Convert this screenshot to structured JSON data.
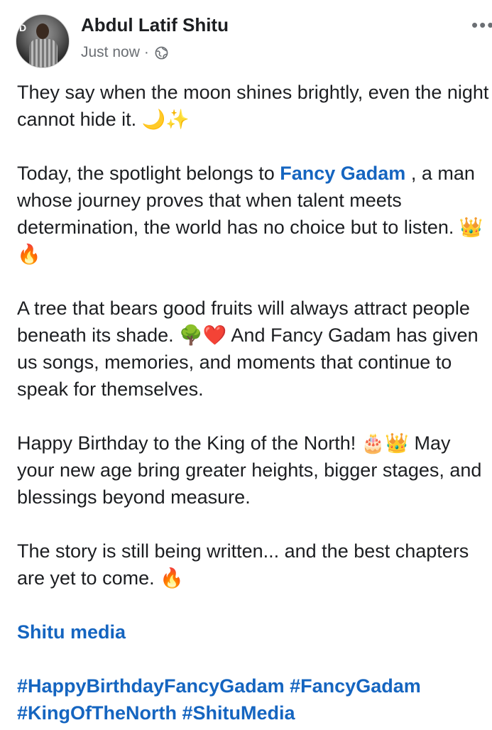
{
  "author": {
    "name": "Abdul Latif Shitu",
    "time": "Just now",
    "separator": "·"
  },
  "post": {
    "p1": "They say when the moon shines brightly, even the night cannot hide it. 🌙✨",
    "p2_before": "Today, the spotlight belongs to ",
    "p2_mention": "Fancy Gadam",
    "p2_after": " , a man whose journey proves that when talent meets determination, the world has no choice but to listen. 👑🔥",
    "p3": "A tree that bears good fruits will always attract people beneath its shade. 🌳❤️ And Fancy Gadam has given us songs, memories, and moments that continue to speak for themselves.",
    "p4": "Happy Birthday to the King of the North! 🎂👑 May your new age bring greater heights, bigger stages, and blessings beyond measure.",
    "p5": "The story is still being written... and the best chapters are yet to come. 🔥",
    "signature": "Shitu media",
    "hashtags": [
      "#HappyBirthdayFancyGadam",
      "#FancyGadam",
      "#KingOfTheNorth",
      "#ShituMedia"
    ]
  },
  "icons": {
    "privacy": "globe-icon",
    "more": "more-options-icon"
  },
  "colors": {
    "link": "#1565c0",
    "text": "#1c1e21",
    "meta": "#6b6f74"
  }
}
